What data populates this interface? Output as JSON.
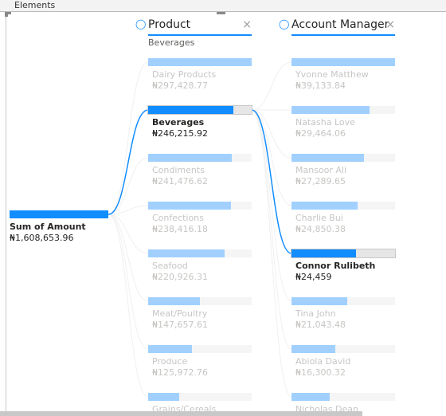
{
  "window": {
    "title": "Elements"
  },
  "root": {
    "label": "Sum of Amount",
    "value": "₦1,608,653.96"
  },
  "columns": [
    {
      "title": "Product",
      "close": "×",
      "selected_caption": "Beverages",
      "icon": "lightbulb-icon",
      "selected_index": 1,
      "items": [
        {
          "label": "Dairy Products",
          "value": "₦297,428.77",
          "fill": 1.0
        },
        {
          "label": "Beverages",
          "value": "₦246,215.92",
          "fill": 0.82
        },
        {
          "label": "Condiments",
          "value": "₦241,476.62",
          "fill": 0.81
        },
        {
          "label": "Confections",
          "value": "₦238,416.18",
          "fill": 0.8
        },
        {
          "label": "Seafood",
          "value": "₦220,926.31",
          "fill": 0.74
        },
        {
          "label": "Meat/Poultry",
          "value": "₦147,657.61",
          "fill": 0.5
        },
        {
          "label": "Produce",
          "value": "₦125,972.76",
          "fill": 0.42
        },
        {
          "label": "Grains/Cereals",
          "value": "",
          "fill": 0.3
        }
      ]
    },
    {
      "title": "Account Manager",
      "close": "×",
      "selected_caption": "",
      "icon": "lightbulb-icon",
      "selected_index": 4,
      "items": [
        {
          "label": "Yvonne Matthew",
          "value": "₦39,133.84",
          "fill": 1.0
        },
        {
          "label": "Natasha Love",
          "value": "₦29,464.06",
          "fill": 0.75
        },
        {
          "label": "Mansoor Ali",
          "value": "₦27,289.65",
          "fill": 0.7
        },
        {
          "label": "Charlie Bui",
          "value": "₦24,850.38",
          "fill": 0.64
        },
        {
          "label": "Connor Rulibeth",
          "value": "₦24,459",
          "fill": 0.62
        },
        {
          "label": "Tina John",
          "value": "₦21,043.48",
          "fill": 0.54
        },
        {
          "label": "Abiola David",
          "value": "₦16,300.32",
          "fill": 0.42
        },
        {
          "label": "Nicholas Dean",
          "value": "",
          "fill": 0.37
        }
      ]
    }
  ],
  "colors": {
    "accent": "#118dff",
    "light": "#a1d0ff"
  }
}
